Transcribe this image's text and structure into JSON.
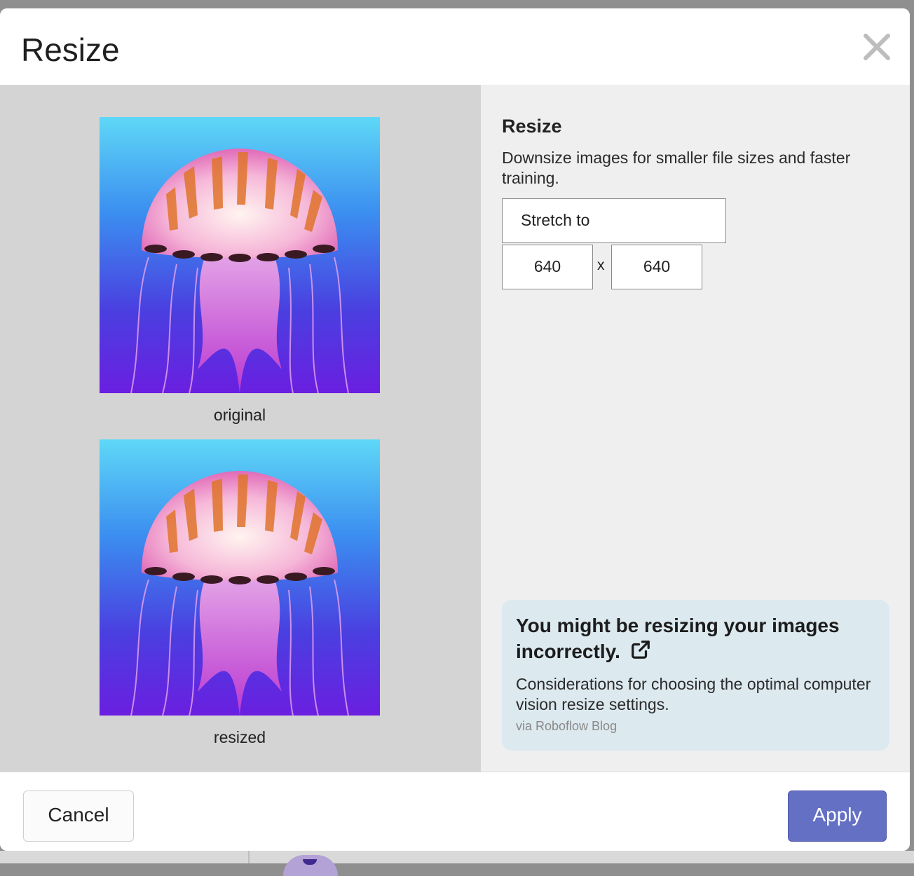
{
  "modal": {
    "title": "Resize"
  },
  "preview": {
    "original_caption": "original",
    "resized_caption": "resized"
  },
  "settings": {
    "title": "Resize",
    "description": "Downsize images for smaller file sizes and faster training.",
    "mode_value": "Stretch to",
    "width_value": "640",
    "height_value": "640",
    "separator": "x"
  },
  "tip": {
    "title": "You might be resizing your images incorrectly.",
    "text": "Considerations for choosing the optimal computer vision resize settings.",
    "source": "via Roboflow Blog",
    "icon": "external-link-icon"
  },
  "footer": {
    "cancel_label": "Cancel",
    "apply_label": "Apply"
  },
  "colors": {
    "apply_bg": "#6470c4",
    "tip_bg": "#dce9ef",
    "preview_bg": "#d4d4d4",
    "settings_bg": "#efefef"
  }
}
